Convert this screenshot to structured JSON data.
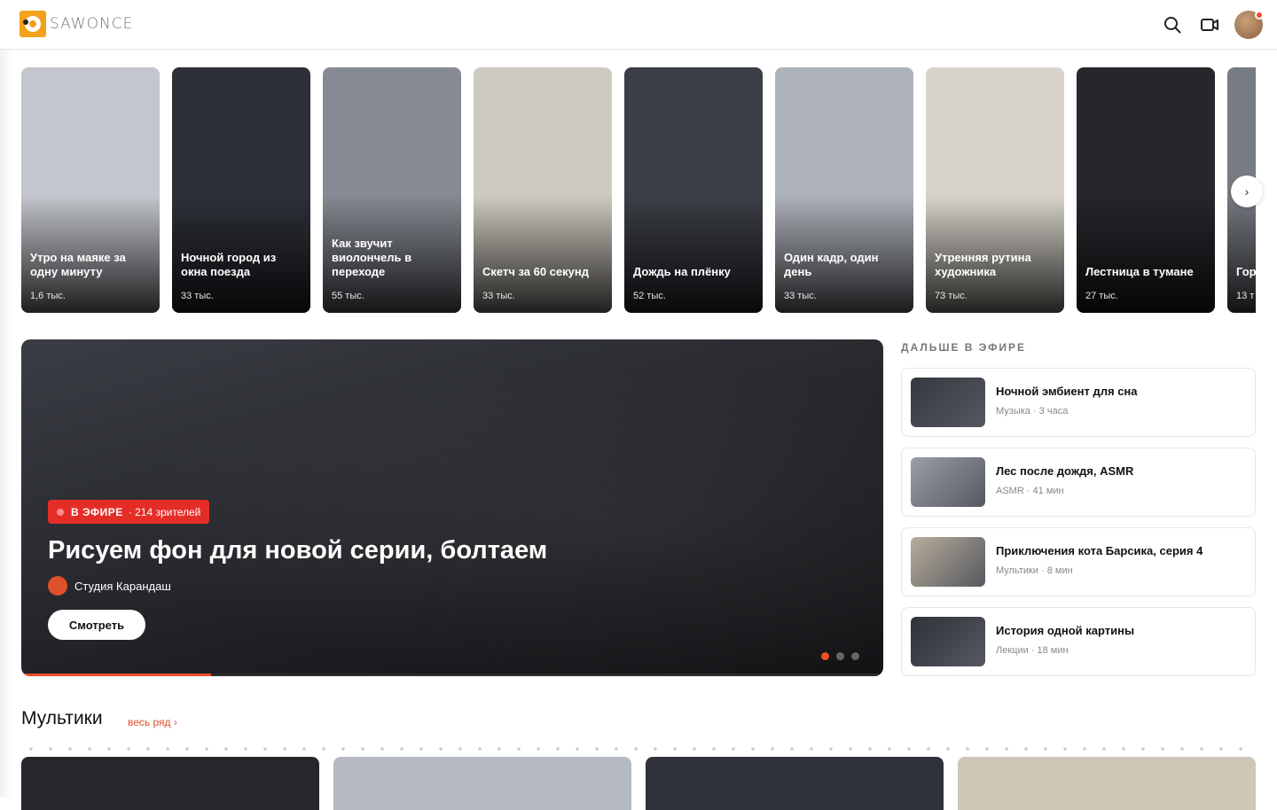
{
  "header": {
    "logo_text": "SAWONCE",
    "icons": [
      "search-icon",
      "camera-icon"
    ]
  },
  "stories": [
    {
      "title": "Утро на маяке за одну минуту",
      "views": "1,6 тыс.",
      "color": "#c3c6cc"
    },
    {
      "title": "Ночной город из окна поезда",
      "views": "33 тыс.",
      "color": "#2d3037"
    },
    {
      "title": "Как звучит виолончель в переходе",
      "views": "55 тыс.",
      "color": "#868a92"
    },
    {
      "title": "Скетч за 60 секунд",
      "views": "33 тыс.",
      "color": "#cfcac1"
    },
    {
      "title": "Дождь на плёнку",
      "views": "52 тыс.",
      "color": "#3b3e45"
    },
    {
      "title": "Один кадр, один день",
      "views": "33 тыс.",
      "color": "#aeb2ba"
    },
    {
      "title": "Утренняя рутина художника",
      "views": "73 тыс.",
      "color": "#d8d4cb"
    },
    {
      "title": "Лестница в тумане",
      "views": "27 тыс.",
      "color": "#25272b"
    },
    {
      "title": "Гор",
      "views": "13 т",
      "color": "#777b82"
    }
  ],
  "hero": {
    "live_label": "В ЭФИРЕ",
    "viewers": "· 214 зрителей",
    "title": "Рисуем фон для новой серии, болтаем",
    "author": "Студия Карандаш",
    "watch_label": "Смотреть",
    "progress": 0.22,
    "slides": 3,
    "active_slide": 0
  },
  "up_next": {
    "heading": "ДАЛЬШЕ В ЭФИРЕ",
    "items": [
      {
        "title": "Ночной эмбиент для сна",
        "meta": "Музыка · 3 часа",
        "color": "#353840"
      },
      {
        "title": "Лес после дождя, ASMR",
        "meta": "ASMR · 41 мин",
        "color": "#9a9ea7"
      },
      {
        "title": "Приключения кота Барсика, серия 4",
        "meta": "Мультики · 8 мин",
        "color": "#b8ad9b"
      },
      {
        "title": "История одной картины",
        "meta": "Лекции · 18 мин",
        "color": "#2f3239"
      }
    ]
  },
  "section": {
    "title": "Мультики",
    "link": "весь ряд ›",
    "cards": [
      "#26282d",
      "#b5b9c1",
      "#2f3238",
      "#cfc6b8"
    ]
  },
  "colors": {
    "accent": "#f04e23",
    "live": "#e52d27"
  }
}
